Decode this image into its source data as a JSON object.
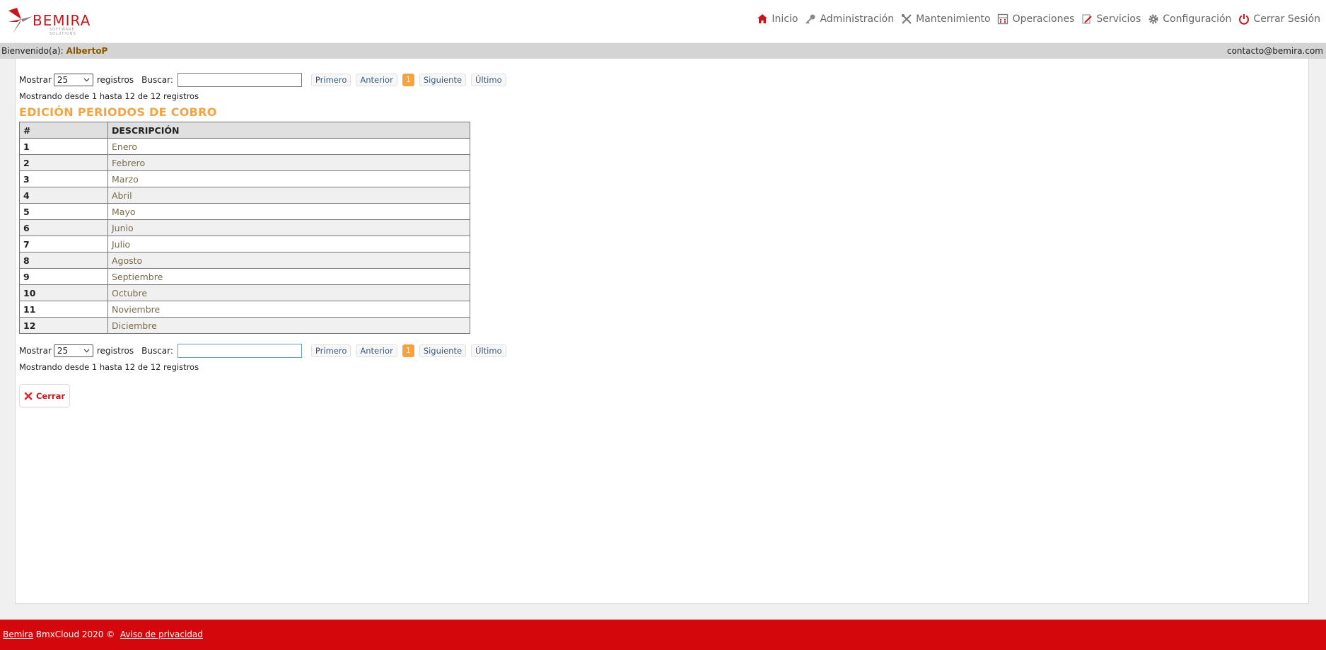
{
  "header": {
    "brand": "BEMIRA",
    "tagline": "SOFTWARE SOLUTIONS",
    "nav": [
      {
        "label": "Inicio",
        "icon": "home-icon"
      },
      {
        "label": "Administración",
        "icon": "key-icon"
      },
      {
        "label": "Mantenimiento",
        "icon": "tools-icon"
      },
      {
        "label": "Operaciones",
        "icon": "calculator-icon"
      },
      {
        "label": "Servicios",
        "icon": "document-edit-icon"
      },
      {
        "label": "Configuración",
        "icon": "gear-icon"
      },
      {
        "label": "Cerrar Sesión",
        "icon": "power-icon"
      }
    ]
  },
  "welcome": {
    "prefix": "Bienvenido(a):",
    "user": "AlbertoP",
    "email": "contacto@bemira.com"
  },
  "controls": {
    "show_label": "Mostrar",
    "page_size": "25",
    "records_label": "registros",
    "search_label": "Buscar:",
    "search_value": "",
    "first": "Primero",
    "previous": "Anterior",
    "current_page": "1",
    "next": "Siguiente",
    "last": "Último",
    "info": "Mostrando desde 1 hasta 12 de 12 registros"
  },
  "page_title": "EDICIÓN PERIODOS DE COBRO",
  "table": {
    "columns": [
      "#",
      "DESCRIPCIÓN"
    ],
    "rows": [
      {
        "num": "1",
        "desc": "Enero"
      },
      {
        "num": "2",
        "desc": "Febrero"
      },
      {
        "num": "3",
        "desc": "Marzo"
      },
      {
        "num": "4",
        "desc": "Abril"
      },
      {
        "num": "5",
        "desc": "Mayo"
      },
      {
        "num": "6",
        "desc": "Junio"
      },
      {
        "num": "7",
        "desc": "Julio"
      },
      {
        "num": "8",
        "desc": "Agosto"
      },
      {
        "num": "9",
        "desc": "Septiembre"
      },
      {
        "num": "10",
        "desc": "Octubre"
      },
      {
        "num": "11",
        "desc": "Noviembre"
      },
      {
        "num": "12",
        "desc": "Diciembre"
      }
    ]
  },
  "close_button": "Cerrar",
  "footer": {
    "brand_link": "Bemira",
    "text": "BmxCloud 2020 ©",
    "privacy_link": "Aviso de privacidad"
  },
  "colors": {
    "accent_orange": "#f5a341",
    "brand_red": "#c4161c",
    "footer_red": "#d4080c"
  }
}
